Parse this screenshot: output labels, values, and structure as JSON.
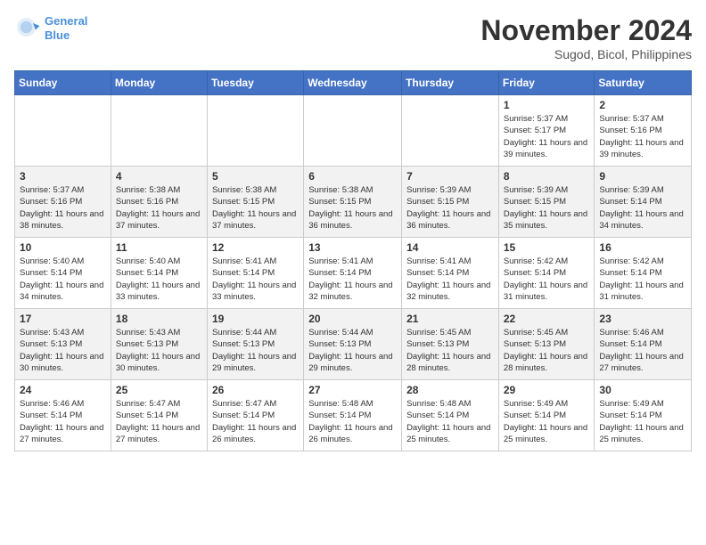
{
  "header": {
    "logo_line1": "General",
    "logo_line2": "Blue",
    "month": "November 2024",
    "location": "Sugod, Bicol, Philippines"
  },
  "weekdays": [
    "Sunday",
    "Monday",
    "Tuesday",
    "Wednesday",
    "Thursday",
    "Friday",
    "Saturday"
  ],
  "weeks": [
    [
      {
        "day": "",
        "info": ""
      },
      {
        "day": "",
        "info": ""
      },
      {
        "day": "",
        "info": ""
      },
      {
        "day": "",
        "info": ""
      },
      {
        "day": "",
        "info": ""
      },
      {
        "day": "1",
        "info": "Sunrise: 5:37 AM\nSunset: 5:17 PM\nDaylight: 11 hours and 39 minutes."
      },
      {
        "day": "2",
        "info": "Sunrise: 5:37 AM\nSunset: 5:16 PM\nDaylight: 11 hours and 39 minutes."
      }
    ],
    [
      {
        "day": "3",
        "info": "Sunrise: 5:37 AM\nSunset: 5:16 PM\nDaylight: 11 hours and 38 minutes."
      },
      {
        "day": "4",
        "info": "Sunrise: 5:38 AM\nSunset: 5:16 PM\nDaylight: 11 hours and 37 minutes."
      },
      {
        "day": "5",
        "info": "Sunrise: 5:38 AM\nSunset: 5:15 PM\nDaylight: 11 hours and 37 minutes."
      },
      {
        "day": "6",
        "info": "Sunrise: 5:38 AM\nSunset: 5:15 PM\nDaylight: 11 hours and 36 minutes."
      },
      {
        "day": "7",
        "info": "Sunrise: 5:39 AM\nSunset: 5:15 PM\nDaylight: 11 hours and 36 minutes."
      },
      {
        "day": "8",
        "info": "Sunrise: 5:39 AM\nSunset: 5:15 PM\nDaylight: 11 hours and 35 minutes."
      },
      {
        "day": "9",
        "info": "Sunrise: 5:39 AM\nSunset: 5:14 PM\nDaylight: 11 hours and 34 minutes."
      }
    ],
    [
      {
        "day": "10",
        "info": "Sunrise: 5:40 AM\nSunset: 5:14 PM\nDaylight: 11 hours and 34 minutes."
      },
      {
        "day": "11",
        "info": "Sunrise: 5:40 AM\nSunset: 5:14 PM\nDaylight: 11 hours and 33 minutes."
      },
      {
        "day": "12",
        "info": "Sunrise: 5:41 AM\nSunset: 5:14 PM\nDaylight: 11 hours and 33 minutes."
      },
      {
        "day": "13",
        "info": "Sunrise: 5:41 AM\nSunset: 5:14 PM\nDaylight: 11 hours and 32 minutes."
      },
      {
        "day": "14",
        "info": "Sunrise: 5:41 AM\nSunset: 5:14 PM\nDaylight: 11 hours and 32 minutes."
      },
      {
        "day": "15",
        "info": "Sunrise: 5:42 AM\nSunset: 5:14 PM\nDaylight: 11 hours and 31 minutes."
      },
      {
        "day": "16",
        "info": "Sunrise: 5:42 AM\nSunset: 5:14 PM\nDaylight: 11 hours and 31 minutes."
      }
    ],
    [
      {
        "day": "17",
        "info": "Sunrise: 5:43 AM\nSunset: 5:13 PM\nDaylight: 11 hours and 30 minutes."
      },
      {
        "day": "18",
        "info": "Sunrise: 5:43 AM\nSunset: 5:13 PM\nDaylight: 11 hours and 30 minutes."
      },
      {
        "day": "19",
        "info": "Sunrise: 5:44 AM\nSunset: 5:13 PM\nDaylight: 11 hours and 29 minutes."
      },
      {
        "day": "20",
        "info": "Sunrise: 5:44 AM\nSunset: 5:13 PM\nDaylight: 11 hours and 29 minutes."
      },
      {
        "day": "21",
        "info": "Sunrise: 5:45 AM\nSunset: 5:13 PM\nDaylight: 11 hours and 28 minutes."
      },
      {
        "day": "22",
        "info": "Sunrise: 5:45 AM\nSunset: 5:13 PM\nDaylight: 11 hours and 28 minutes."
      },
      {
        "day": "23",
        "info": "Sunrise: 5:46 AM\nSunset: 5:14 PM\nDaylight: 11 hours and 27 minutes."
      }
    ],
    [
      {
        "day": "24",
        "info": "Sunrise: 5:46 AM\nSunset: 5:14 PM\nDaylight: 11 hours and 27 minutes."
      },
      {
        "day": "25",
        "info": "Sunrise: 5:47 AM\nSunset: 5:14 PM\nDaylight: 11 hours and 27 minutes."
      },
      {
        "day": "26",
        "info": "Sunrise: 5:47 AM\nSunset: 5:14 PM\nDaylight: 11 hours and 26 minutes."
      },
      {
        "day": "27",
        "info": "Sunrise: 5:48 AM\nSunset: 5:14 PM\nDaylight: 11 hours and 26 minutes."
      },
      {
        "day": "28",
        "info": "Sunrise: 5:48 AM\nSunset: 5:14 PM\nDaylight: 11 hours and 25 minutes."
      },
      {
        "day": "29",
        "info": "Sunrise: 5:49 AM\nSunset: 5:14 PM\nDaylight: 11 hours and 25 minutes."
      },
      {
        "day": "30",
        "info": "Sunrise: 5:49 AM\nSunset: 5:14 PM\nDaylight: 11 hours and 25 minutes."
      }
    ]
  ]
}
